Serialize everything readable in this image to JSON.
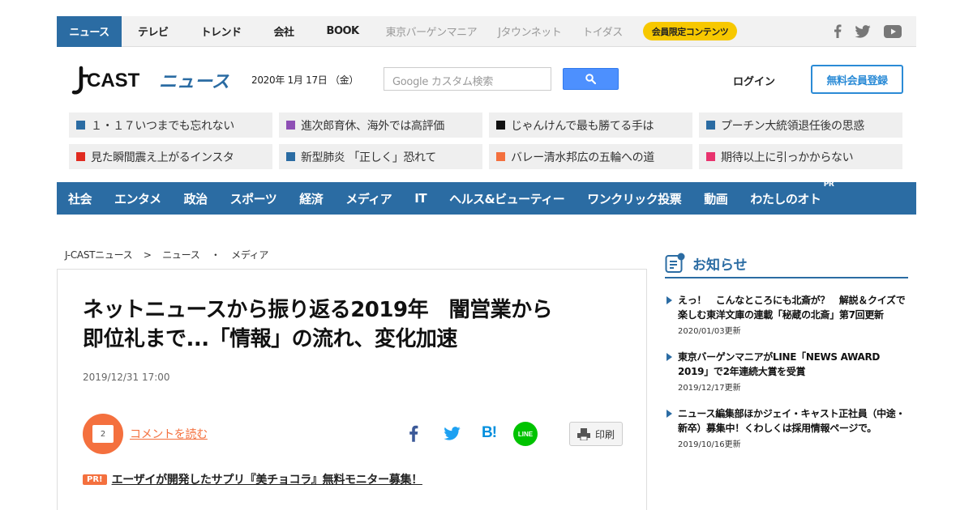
{
  "topnav": {
    "items": [
      "ニュース",
      "テレビ",
      "トレンド",
      "会社",
      "BOOK"
    ],
    "gray_items": [
      "東京バーゲンマニア",
      "Jタウンネット",
      "トイダス"
    ],
    "member_label": "会員限定コンテンツ",
    "social_icons": [
      "facebook-icon",
      "twitter-icon",
      "youtube-icon"
    ]
  },
  "header": {
    "logo_text": "J-CAST ニュース",
    "date": "2020年 1月 17日 （金）",
    "search_placeholder": "Google カスタム検索",
    "login_label": "ログイン",
    "register_label": "無料会員登録"
  },
  "topics": [
    {
      "label": "１・１７いつまでも忘れない",
      "color": "#2b6ca3"
    },
    {
      "label": "進次郎育休、海外では高評価",
      "color": "#8e4fb5"
    },
    {
      "label": "じゃんけんで最も勝てる手は",
      "color": "#111111"
    },
    {
      "label": "プーチン大統領退任後の思惑",
      "color": "#2b6ca3"
    },
    {
      "label": "見た瞬間震え上がるインスタ",
      "color": "#e02b20"
    },
    {
      "label": "新型肺炎 「正しく」恐れて",
      "color": "#2b6ca3"
    },
    {
      "label": "バレー清水邦広の五輪への道",
      "color": "#f4703e"
    },
    {
      "label": "期待以上に引っかからない",
      "color": "#e8336e"
    }
  ],
  "categories": [
    "社会",
    "エンタメ",
    "政治",
    "スポーツ",
    "経済",
    "メディア",
    "IT",
    "ヘルス&ビューティー",
    "ワンクリック投票",
    "動画",
    "わたしのオト"
  ],
  "category_pr": "PR",
  "breadcrumb": [
    "J-CASTニュース",
    ">",
    "ニュース",
    "・",
    "メディア"
  ],
  "article": {
    "title_line1": "ネットニュースから振り返る2019年　闇営業から",
    "title_line2": "即位礼まで...「情報」の流れ、変化加速",
    "date": "2019/12/31 17:00",
    "comment_count": "2",
    "comment_link": "コメントを読む",
    "share_icons": [
      "facebook-icon",
      "twitter-icon",
      "hatena-bookmark-icon",
      "line-icon"
    ],
    "hatena_label": "B!",
    "line_label": "LINE",
    "print_label": "印刷",
    "pr_badge": "PR!",
    "pr_text": "エーザイが開発したサプリ『美チョコラ』無料モニター募集！"
  },
  "sidebar": {
    "heading": "お知らせ",
    "news": [
      {
        "text": "えっ！　こんなところにも北斎が？　解説＆クイズで楽しむ東洋文庫の連載「秘蔵の北斎」第7回更新",
        "date": "2020/01/03更新"
      },
      {
        "text": "東京バーゲンマニアがLINE「NEWS AWARD 2019」で2年連続大賞を受賞",
        "date": "2019/12/17更新"
      },
      {
        "text": "ニュース編集部ほかジェイ・キャスト正社員（中途・新卒）募集中！くわしくは採用情報ページで。",
        "date": "2019/10/16更新"
      }
    ]
  },
  "colors": {
    "brand_blue": "#2b6ca3",
    "accent_orange": "#f4703e",
    "member_yellow": "#f7c800",
    "search_blue": "#4d90fe"
  }
}
